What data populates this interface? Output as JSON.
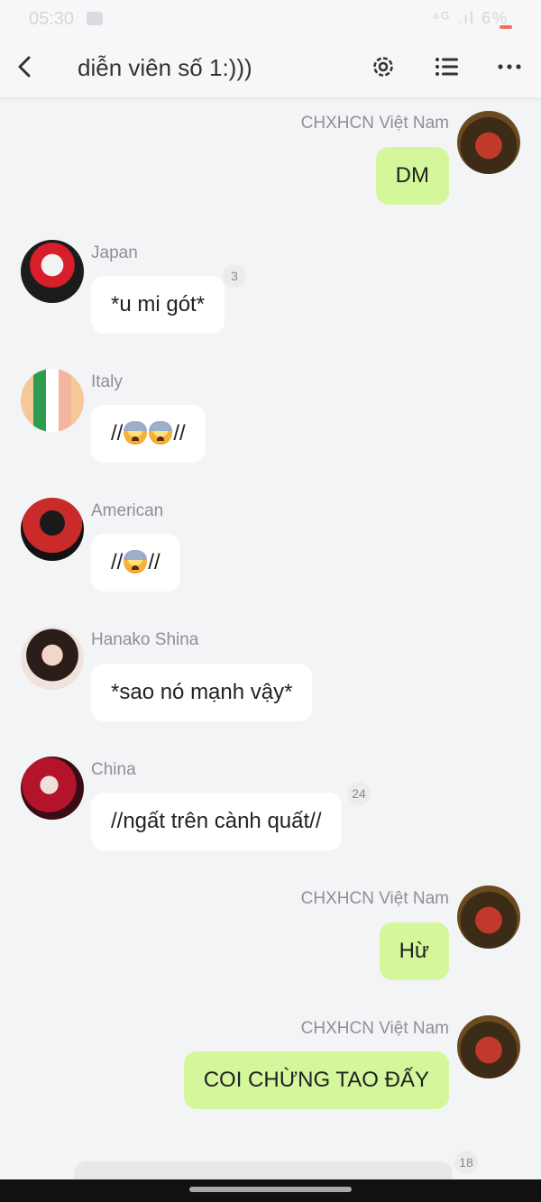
{
  "status": {
    "time": "05:30",
    "right": "⁴ᴳ .ıl 6%"
  },
  "header": {
    "title": "diễn viên số 1:)))"
  },
  "messages": [
    {
      "sender": "CHXHCN Việt Nam",
      "text": "DM",
      "side": "out"
    },
    {
      "sender": "Japan",
      "text": "*u mi gót*",
      "badge": "3",
      "side": "in"
    },
    {
      "sender": "Italy",
      "text_pre": "//",
      "text_post": "//",
      "emoji_count": 2,
      "side": "in"
    },
    {
      "sender": "American",
      "text_pre": "//",
      "text_post": "//",
      "emoji_count": 1,
      "side": "in"
    },
    {
      "sender": "Hanako Shina",
      "text": "*sao nó mạnh vậy*",
      "side": "in"
    },
    {
      "sender": "China",
      "text": "//ngất trên cành quất//",
      "badge": "24",
      "side": "in"
    },
    {
      "sender": "CHXHCN Việt Nam",
      "text": "Hừ",
      "side": "out"
    },
    {
      "sender": "CHXHCN Việt Nam",
      "text": "COI CHỪNG TAO ĐẤY",
      "side": "out"
    }
  ],
  "partial": {
    "badge": "18"
  },
  "colors": {
    "out_bubble": "#d4f79b",
    "in_bubble": "#ffffff",
    "background": "#f3f4f6"
  }
}
